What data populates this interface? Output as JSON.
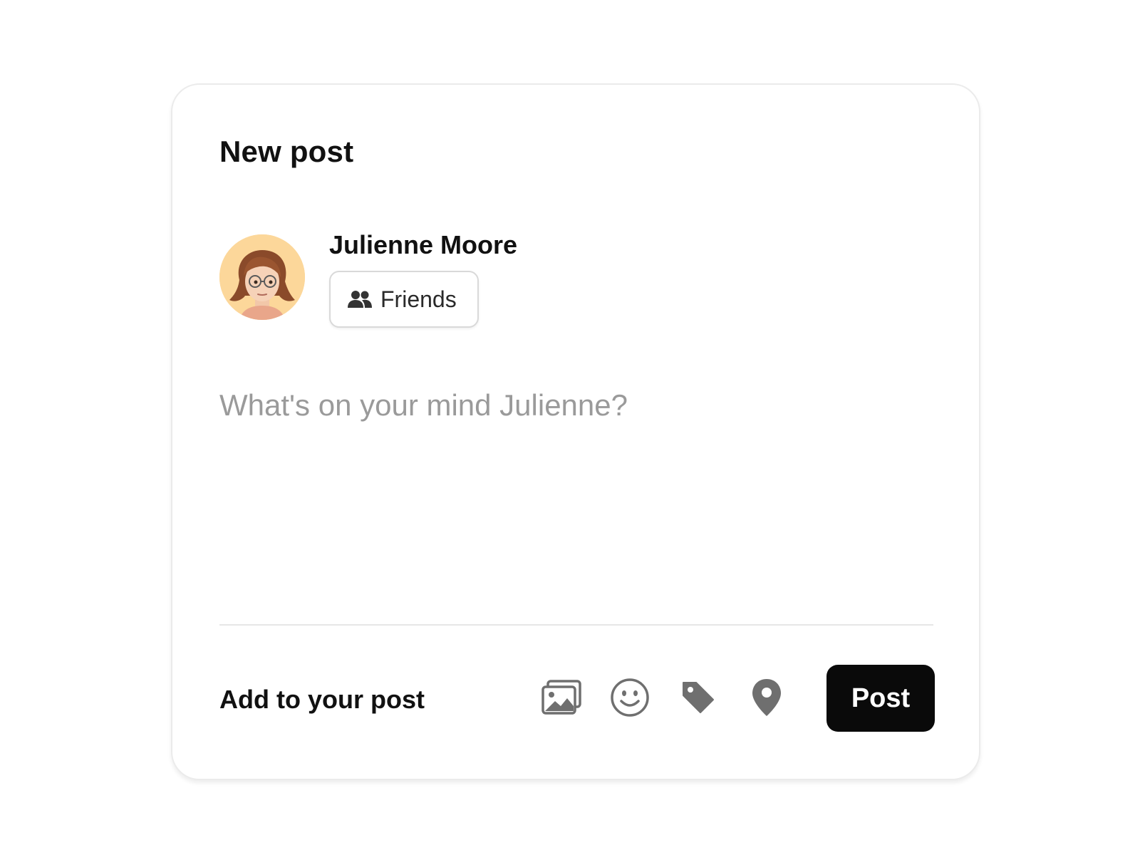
{
  "composer_card": {
    "title": "New post",
    "user": {
      "name": "Julienne Moore",
      "avatar_icon": "memoji-avatar",
      "avatar_bg": "#fcd79a"
    },
    "audience": {
      "label": "Friends",
      "icon": "people-icon"
    },
    "input": {
      "value": "",
      "placeholder": "What's on your mind Julienne?"
    },
    "footer": {
      "add_label": "Add to your post",
      "tools": [
        {
          "icon": "photo-icon"
        },
        {
          "icon": "emoji-icon"
        },
        {
          "icon": "tag-icon"
        },
        {
          "icon": "location-pin-icon"
        }
      ],
      "post_label": "Post"
    }
  },
  "colors": {
    "text_primary": "#111111",
    "placeholder": "#9a9a9a",
    "icon_gray": "#6f6f6f",
    "post_button_bg": "#0a0a0a",
    "post_button_text": "#ffffff",
    "card_border": "#ebebeb"
  }
}
